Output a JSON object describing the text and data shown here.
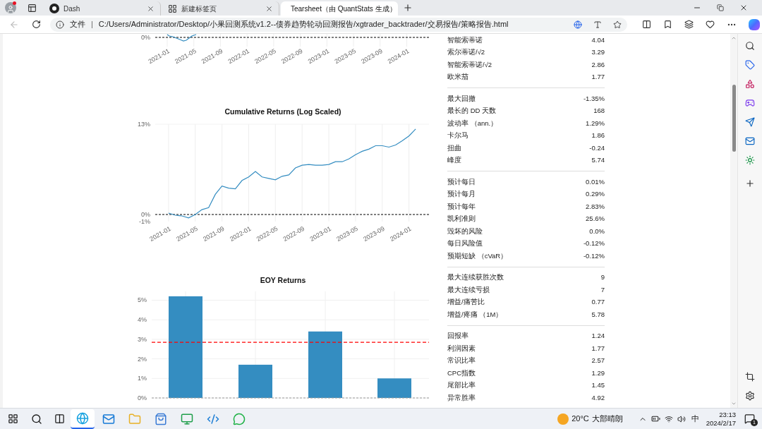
{
  "browser": {
    "tabs": [
      {
        "title": "Dash",
        "selected": false,
        "kind": "dash"
      },
      {
        "title": "新建标签页",
        "selected": false,
        "kind": "newtab"
      },
      {
        "title": "Tearsheet（由 QuantStats 生成）",
        "selected": true,
        "kind": "chart"
      }
    ],
    "back_button": {
      "disabled": true
    },
    "address_bar": {
      "scheme_label": "文件",
      "separator": "|",
      "url": "C:/Users/Administrator/Desktop/小果回测系统v1.2--债券趋势轮动回测报告/xgtrader_backtrader/交易报告/策略报告.html"
    }
  },
  "top_chart": {
    "ytick": "0%",
    "xticks": [
      "2021-01",
      "2021-05",
      "2021-09",
      "2022-01",
      "2022-05",
      "2022-09",
      "2023-01",
      "2023-05",
      "2023-09",
      "2024-01"
    ]
  },
  "cumulative_chart": {
    "chart_data": {
      "type": "line",
      "title": "Cumulative Returns (Log Scaled)",
      "x": [
        "2021-01",
        "2021-02",
        "2021-03",
        "2021-04",
        "2021-05",
        "2021-06",
        "2021-07",
        "2021-08",
        "2021-09",
        "2021-10",
        "2021-11",
        "2021-12",
        "2022-01",
        "2022-02",
        "2022-03",
        "2022-04",
        "2022-05",
        "2022-06",
        "2022-07",
        "2022-08",
        "2022-09",
        "2022-10",
        "2022-11",
        "2022-12",
        "2023-01",
        "2023-02",
        "2023-03",
        "2023-04",
        "2023-05",
        "2023-06",
        "2023-07",
        "2023-08",
        "2023-09",
        "2023-10",
        "2023-11",
        "2023-12",
        "2024-01",
        "2024-02"
      ],
      "series": [
        {
          "color": "#348dc1",
          "values": [
            0.2,
            -0.1,
            -0.2,
            -0.5,
            0.0,
            0.7,
            1.0,
            2.9,
            4.1,
            3.8,
            3.7,
            4.9,
            5.4,
            6.2,
            5.4,
            5.2,
            5.0,
            5.5,
            5.7,
            6.7,
            7.1,
            7.2,
            7.1,
            7.1,
            7.2,
            7.6,
            7.6,
            8.0,
            8.6,
            9.1,
            9.4,
            9.9,
            9.9,
            9.7,
            10.0,
            10.6,
            11.3,
            12.3
          ]
        }
      ],
      "xlim": [
        "2020-11",
        "2024-04"
      ],
      "ylim": [
        -1,
        13
      ],
      "yticks": [
        {
          "value": -1,
          "label": "-1%"
        },
        {
          "value": 0,
          "label": "0%"
        },
        {
          "value": 13,
          "label": "13%"
        }
      ],
      "xticks": [
        "2021-01",
        "2021-05",
        "2021-09",
        "2022-01",
        "2022-05",
        "2022-09",
        "2023-01",
        "2023-05",
        "2023-09",
        "2024-01"
      ],
      "grid": true,
      "ref_lines": [
        {
          "axis": "y",
          "value": 0,
          "color": "#000000"
        }
      ]
    }
  },
  "eoy_chart": {
    "chart_data": {
      "type": "bar",
      "title": "EOY Returns",
      "series": [
        {
          "color": "#348dc1",
          "values": [
            5.2,
            1.7,
            3.4,
            1.0
          ]
        }
      ],
      "ylim": [
        0,
        5.45
      ],
      "yticks": [
        {
          "value": 0,
          "label": "0%"
        },
        {
          "value": 1,
          "label": "1%"
        },
        {
          "value": 2,
          "label": "2%"
        },
        {
          "value": 3,
          "label": "3%"
        },
        {
          "value": 4,
          "label": "4%"
        },
        {
          "value": 5,
          "label": "5%"
        }
      ],
      "grid": true,
      "ref_lines": [
        {
          "axis": "y",
          "value": 2.85,
          "color": "#ff0000"
        }
      ]
    }
  },
  "metrics": [
    {
      "rows": [
        {
          "label": "智能索蒂诺",
          "value": "4.04"
        },
        {
          "label": "索尔蒂诺/√2",
          "value": "3.29"
        },
        {
          "label": "智能索蒂诺/√2",
          "value": "2.86"
        },
        {
          "label": "欧米茄",
          "value": "1.77"
        }
      ]
    },
    {
      "rows": [
        {
          "label": "最大回撤",
          "value": "-1.35%"
        },
        {
          "label": "最长的 DD 天数",
          "value": "168"
        },
        {
          "label": "波动率 （ann.）",
          "value": "1.29%"
        },
        {
          "label": "卡尔马",
          "value": "1.86"
        },
        {
          "label": "扭曲",
          "value": "-0.24"
        },
        {
          "label": "峰度",
          "value": "5.74"
        }
      ]
    },
    {
      "rows": [
        {
          "label": "预计每日",
          "value": "0.01%"
        },
        {
          "label": "预计每月",
          "value": "0.29%"
        },
        {
          "label": "预计每年",
          "value": "2.83%"
        },
        {
          "label": "凯利准则",
          "value": "25.6%"
        },
        {
          "label": "毁坏的风险",
          "value": "0.0%"
        },
        {
          "label": "每日风险值",
          "value": "-0.12%"
        },
        {
          "label": "预期短缺 （cVaR）",
          "value": "-0.12%"
        }
      ]
    },
    {
      "rows": [
        {
          "label": "最大连续获胜次数",
          "value": "9"
        },
        {
          "label": "最大连续亏损",
          "value": "7"
        },
        {
          "label": "增益/痛苦比",
          "value": "0.77"
        },
        {
          "label": "增益/疼痛 （1M）",
          "value": "5.78"
        }
      ]
    },
    {
      "rows": [
        {
          "label": "回报率",
          "value": "1.24"
        },
        {
          "label": "利润因素",
          "value": "1.77"
        },
        {
          "label": "常识比率",
          "value": "2.57"
        },
        {
          "label": "CPC指数",
          "value": "1.29"
        },
        {
          "label": "尾部比率",
          "value": "1.45"
        },
        {
          "label": "异常胜率",
          "value": "4.92"
        }
      ]
    }
  ],
  "taskbar": {
    "apps": [
      {
        "kind": "edge",
        "selected": true
      },
      {
        "kind": "mail",
        "selected": false
      },
      {
        "kind": "folder",
        "selected": false
      },
      {
        "kind": "store",
        "selected": false
      },
      {
        "kind": "terminal",
        "selected": false
      },
      {
        "kind": "vscode",
        "selected": false
      },
      {
        "kind": "wechat",
        "selected": false
      }
    ],
    "temperature": "20°C",
    "weather": "大部晴朗",
    "ime": "中",
    "time": "23:13",
    "date": "2024/2/17",
    "notifications": "1"
  }
}
